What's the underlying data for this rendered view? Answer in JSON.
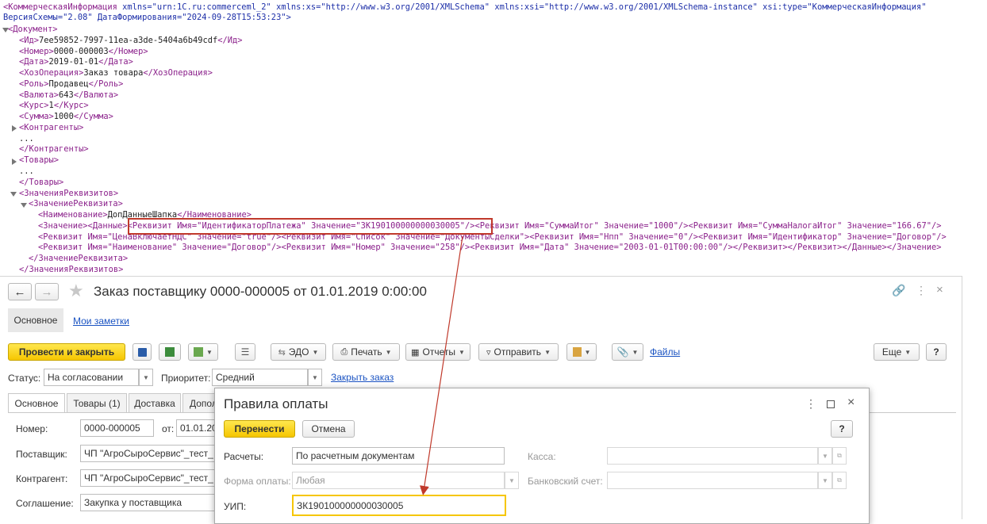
{
  "xml": {
    "header1_tag": "<КоммерческаяИнформация",
    "header1_rest": " xmlns=\"urn:1C.ru:commerceml_2\" xmlns:xs=\"http://www.w3.org/2001/XMLSchema\" xmlns:xsi=\"http://www.w3.org/2001/XMLSchema-instance\" xsi:type=\"КоммерческаяИнформация\"",
    "header2": "ВерсияСхемы=\"2.08\" ДатаФормирования=\"2024-09-28T15:53:23\">",
    "doc_open": "<Документ>",
    "fields": [
      {
        "open": "<Ид>",
        "value": "7ee59852-7997-11ea-a3de-5404a6b49cdf",
        "close": "</Ид>"
      },
      {
        "open": "<Номер>",
        "value": "0000-000003",
        "close": "</Номер>"
      },
      {
        "open": "<Дата>",
        "value": "2019-01-01",
        "close": "</Дата>"
      },
      {
        "open": "<ХозОперация>",
        "value": "Заказ товара",
        "close": "</ХозОперация>"
      },
      {
        "open": "<Роль>",
        "value": "Продавец",
        "close": "</Роль>"
      },
      {
        "open": "<Валюта>",
        "value": "643",
        "close": "</Валюта>"
      },
      {
        "open": "<Курс>",
        "value": "1",
        "close": "</Курс>"
      },
      {
        "open": "<Сумма>",
        "value": "1000",
        "close": "</Сумма>"
      }
    ],
    "kontragenty_open": "<Контрагенты>",
    "ellipsis": "...",
    "kontragenty_close": "</Контрагенты>",
    "tovary_open": "<Товары>",
    "tovary_close": "</Товары>",
    "zr_open": "<ЗначенияРеквизитов>",
    "zr1_open": "<ЗначениеРеквизита>",
    "name_open": "<Наименование>",
    "name_value": "ДопДанныеШапка",
    "name_close": "</Наименование>",
    "line_a": "<Значение><Данные><Реквизит Имя=\"ИдентификаторПлатежа\" Значение=\"ЗК190100000000030005\"/><Реквизит Имя=\"СуммаИтог\" Значение=\"1000\"/><Реквизит Имя=\"СуммаНалогаИтог\" Значение=\"166.67\"/>",
    "line_b": "<Реквизит Имя=\"ЦенаВключаетНДС\" Значение=\"true\"/><Реквизит Имя=\"Список\" Значение=\"ДокументыСделки\"><Реквизит Имя=\"Нпп\" Значение=\"0\"/><Реквизит Имя=\"Идентификатор\" Значение=\"Договор\"/>",
    "line_c": "<Реквизит Имя=\"Наименование\" Значение=\"Договор\"/><Реквизит Имя=\"Номер\" Значение=\"258\"/><Реквизит Имя=\"Дата\" Значение=\"2003-01-01T00:00:00\"/></Реквизит></Реквизит></Данные></Значение>",
    "zr1_close": "</ЗначениеРеквизита>",
    "zr_close": "</ЗначенияРеквизитов>"
  },
  "form": {
    "title": "Заказ поставщику 0000-000005 от 01.01.2019 0:00:00",
    "nav_main": "Основное",
    "nav_notes": "Мои заметки",
    "btn_post_close": "Провести и закрыть",
    "btn_edo": "ЭДО",
    "btn_print": "Печать",
    "btn_reports": "Отчеты",
    "btn_send": "Отправить",
    "link_files": "Файлы",
    "btn_more": "Еще",
    "btn_help": "?",
    "status_label": "Статус:",
    "status_value": "На согласовании",
    "priority_label": "Приоритет:",
    "priority_value": "Средний",
    "link_close_order": "Закрыть заказ",
    "tabs": [
      "Основное",
      "Товары (1)",
      "Доставка",
      "Допол"
    ],
    "number_label": "Номер:",
    "number_value": "0000-000005",
    "from_label": "от:",
    "from_value": "01.01.20",
    "supplier_label": "Поставщик:",
    "supplier_value": "ЧП \"АгроСыроСервис\"_тест_",
    "counterparty_label": "Контрагент:",
    "counterparty_value": "ЧП \"АгроСыроСервис\"_тест_",
    "agreement_label": "Соглашение:",
    "agreement_value": "Закупка у поставщика"
  },
  "dialog": {
    "title": "Правила оплаты",
    "btn_transfer": "Перенести",
    "btn_cancel": "Отмена",
    "btn_help": "?",
    "payments_label": "Расчеты:",
    "payments_value": "По расчетным документам",
    "cash_label": "Касса:",
    "pay_form_label": "Форма оплаты:",
    "pay_form_value": "Любая",
    "bank_label": "Банковский счет:",
    "uip_label": "УИП:",
    "uip_value": "ЗК190100000000030005"
  },
  "colors": {
    "accent_yellow": "#f6c600",
    "highlight_red": "#c0392b",
    "link_blue": "#1a53c2",
    "xml_tag": "#8a1f8a"
  }
}
